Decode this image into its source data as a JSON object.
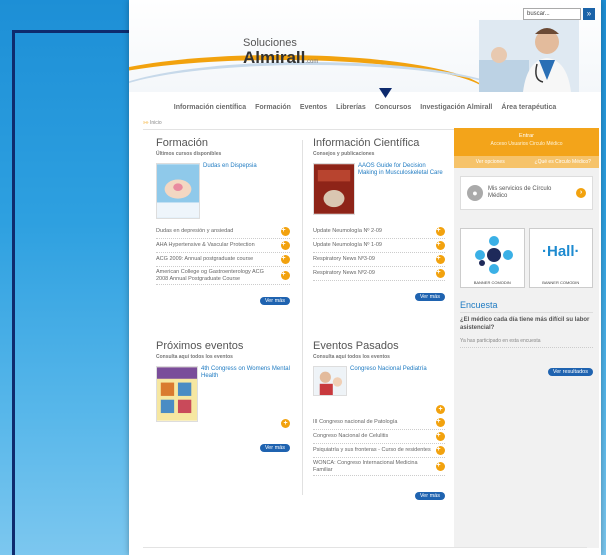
{
  "header": {
    "logo_line1": "Soluciones",
    "logo_line2": "Almirall",
    "logo_suffix": ".com",
    "search_placeholder": "buscar...",
    "search_button": "»"
  },
  "nav": {
    "items": [
      "Información científica",
      "Formación",
      "Eventos",
      "Librerías",
      "Concursos",
      "Investigación Almirall",
      "Área terapéutica"
    ]
  },
  "breadcrumb": {
    "arrow": "»»",
    "label": "Inicio"
  },
  "formacion": {
    "title": "Formación",
    "subtitle": "Últimos cursos disponibles",
    "featured": "Dudas en Dispepsia",
    "items": [
      "Dudas en depresión y ansiedad",
      "AHA Hypertensive & Vascular Protection",
      "ACG 2009: Annual postgraduate course",
      "American College og Gastroenterology ACG 2008 Annual Postgraduate Course"
    ],
    "more": "Ver más"
  },
  "informacion": {
    "title": "Información Científica",
    "subtitle": "Consejos y publicaciones",
    "featured": "AAOS Guide for Decision Making in Musculoskeletal Care",
    "items": [
      "Update Neumología Nº 2-09",
      "Update Neumología Nº 1-09",
      "Respiratory News Nº3-09",
      "Respiratory News Nº2-09"
    ],
    "more": "Ver más"
  },
  "proximos": {
    "title": "Próximos eventos",
    "subtitle": "Consulta aquí todos los eventos",
    "featured": "4th Congress on Womens Mental Health",
    "more": "Ver más"
  },
  "pasados": {
    "title": "Eventos Pasados",
    "subtitle": "Consulta aquí todos los eventos",
    "featured": "Congreso Nacional Pediatría",
    "items": [
      "III Congreso nacional de Patología",
      "Congreso Nacional de Celulitis",
      "Psiquiatría y sus fronteras - Curso de residentes",
      "WONCA: Congreso Internacional Medicina Familiar"
    ],
    "more": "Ver más"
  },
  "sidebar": {
    "top_line1": "Entrar",
    "top_line2": "Acceso Usuarios Circulo Médico",
    "tab1": "Ver opciones",
    "tab2": "¿Qué es Circulo Médico?",
    "circulo": "Mis servicios de Círculo Médico",
    "ad1_caption": "BANNER COMODIN",
    "ad2_brand": "·Hall·",
    "ad2_caption": "BANNER COMODIN",
    "encuesta_title": "Encuesta",
    "encuesta_question": "¿El médico cada día tiene más difícil su labor asistencial?",
    "encuesta_note": "Ya has participado en esta encuesta",
    "encuesta_more": "Ver resultados"
  },
  "colors": {
    "accent": "#f2a20e",
    "link": "#1f7bc2",
    "button": "#1f63b0",
    "background": "#2ea0e0"
  }
}
